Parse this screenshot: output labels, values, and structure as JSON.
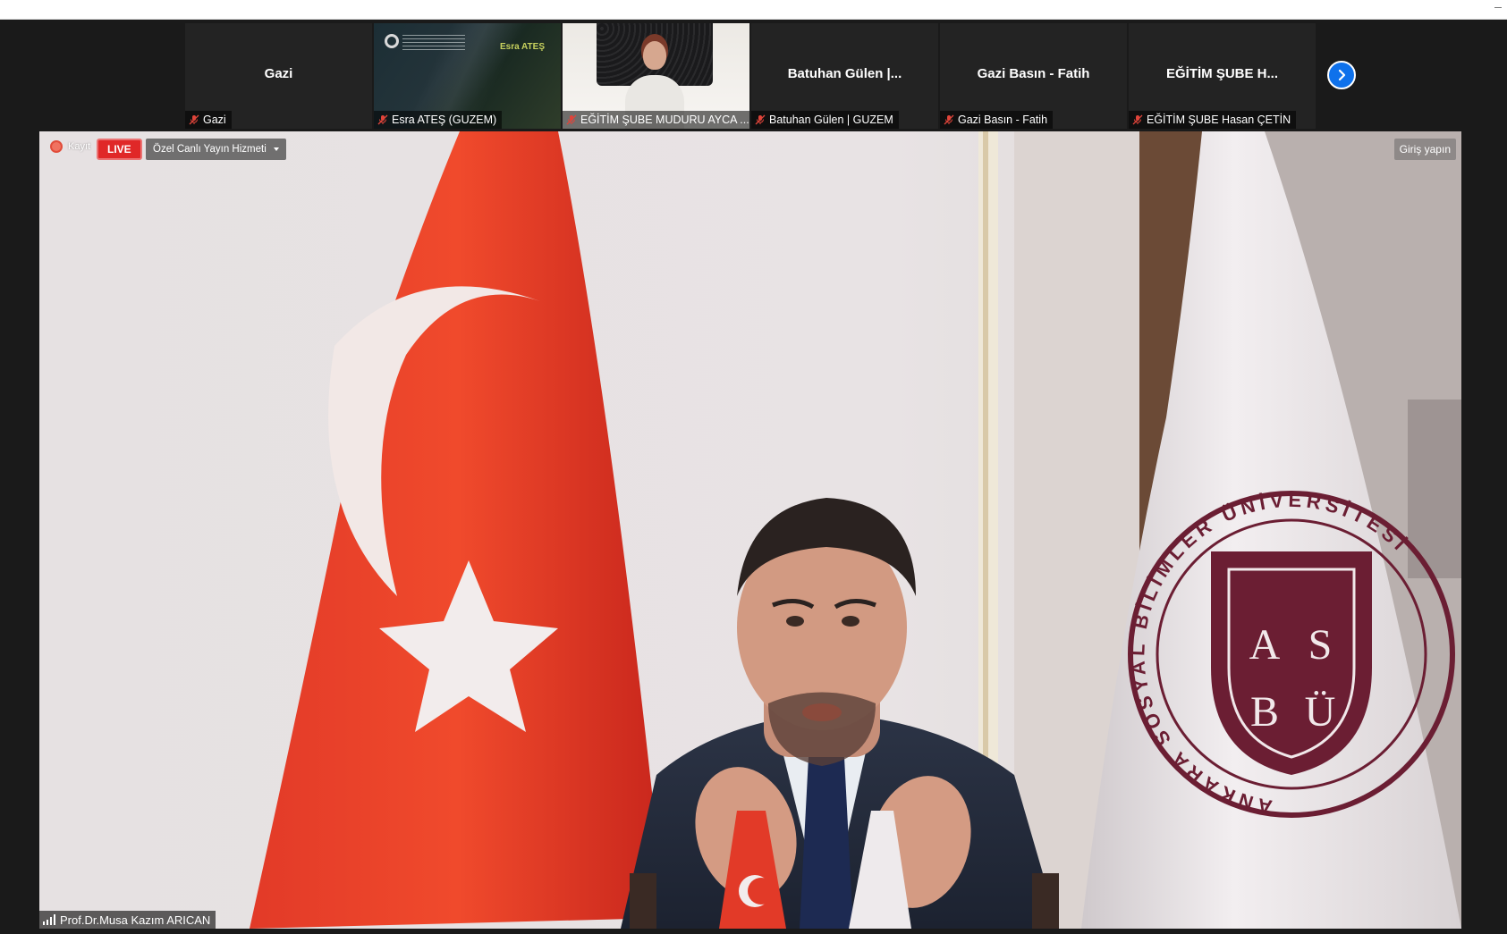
{
  "participants": [
    {
      "display_name": "Gazi",
      "label": "Gazi",
      "video": false
    },
    {
      "label": "Esra ATEŞ (GUZEM)",
      "video": true,
      "slide_name": "Esra ATEŞ"
    },
    {
      "label": "EĞİTİM ŞUBE MUDURU AYCA ...",
      "video": true
    },
    {
      "display_name": "Batuhan Gülen |...",
      "label": "Batuhan Gülen | GUZEM",
      "video": false
    },
    {
      "display_name": "Gazi Basın - Fatih",
      "label": "Gazi Basın - Fatih",
      "video": false
    },
    {
      "display_name": "EĞİTİM ŞUBE H...",
      "label": "EĞİTİM ŞUBE Hasan ÇETİN",
      "video": false
    }
  ],
  "main_video": {
    "recording_label": "Kayıt",
    "live_label": "LIVE",
    "streaming_service": "Özel Canlı Yayın Hizmeti",
    "signin_label": "Giriş yapın",
    "speaker_name": "Prof.Dr.Musa Kazım ARICAN",
    "emblem_ring_text": "ANKARA SOSYAL BİLİMLER ÜNİVERSİTESİ",
    "emblem_letters": [
      "A",
      "S",
      "B",
      "Ü"
    ]
  },
  "icons": {
    "muted_mic": "muted-mic-icon",
    "next_page": "chevron-right-icon",
    "signal": "signal-strength-icon",
    "recording": "recording-dot-icon",
    "dropdown": "caret-down-icon"
  },
  "colors": {
    "accent_blue": "#0e71eb",
    "live_red": "#e02828",
    "mute_red": "#e0443a",
    "flag_red": "#e1342a",
    "emblem_maroon": "#6b1e33"
  }
}
